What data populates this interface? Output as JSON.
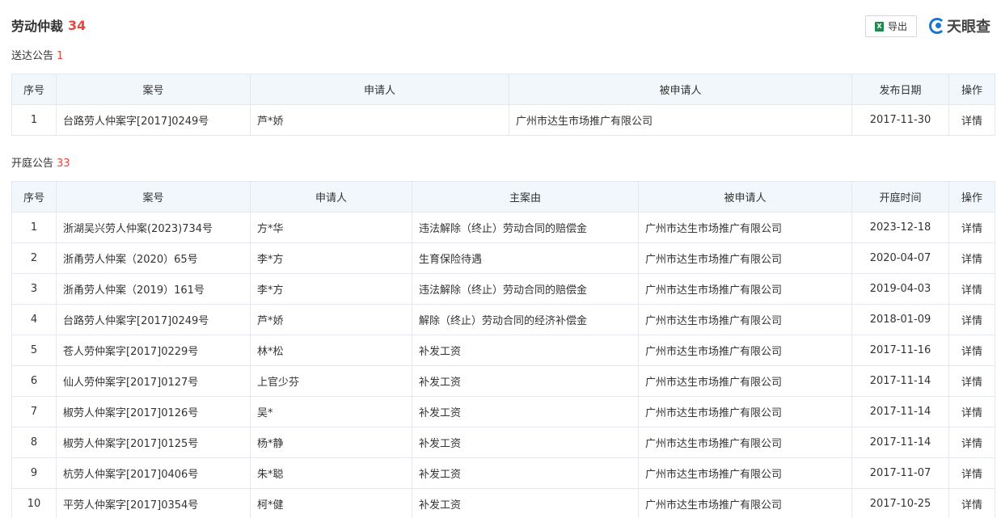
{
  "header": {
    "title": "劳动仲裁",
    "count": "34"
  },
  "toolbar": {
    "export_label": "导出",
    "excel_icon_text": "X"
  },
  "logo": {
    "text": "天眼查"
  },
  "service_notice": {
    "label": "送达公告",
    "count": "1",
    "columns": [
      "序号",
      "案号",
      "申请人",
      "被申请人",
      "发布日期",
      "操作"
    ],
    "rows": [
      {
        "no": "1",
        "case_no": "台路劳人仲案字[2017]0249号",
        "applicant": "芦*娇",
        "respondent": "广州市达生市场推广有限公司",
        "date": "2017-11-30",
        "action": "详情"
      }
    ]
  },
  "court_notice": {
    "label": "开庭公告",
    "count": "33",
    "columns": [
      "序号",
      "案号",
      "申请人",
      "主案由",
      "被申请人",
      "开庭时间",
      "操作"
    ],
    "rows": [
      {
        "no": "1",
        "case_no": "浙湖吴兴劳人仲案(2023)734号",
        "applicant": "方*华",
        "cause": "违法解除（终止）劳动合同的赔偿金",
        "respondent": "广州市达生市场推广有限公司",
        "date": "2023-12-18",
        "action": "详情"
      },
      {
        "no": "2",
        "case_no": "浙甬劳人仲案（2020）65号",
        "applicant": "李*方",
        "cause": "生育保险待遇",
        "respondent": "广州市达生市场推广有限公司",
        "date": "2020-04-07",
        "action": "详情"
      },
      {
        "no": "3",
        "case_no": "浙甬劳人仲案（2019）161号",
        "applicant": "李*方",
        "cause": "违法解除（终止）劳动合同的赔偿金",
        "respondent": "广州市达生市场推广有限公司",
        "date": "2019-04-03",
        "action": "详情"
      },
      {
        "no": "4",
        "case_no": "台路劳人仲案字[2017]0249号",
        "applicant": "芦*娇",
        "cause": "解除（终止）劳动合同的经济补偿金",
        "respondent": "广州市达生市场推广有限公司",
        "date": "2018-01-09",
        "action": "详情"
      },
      {
        "no": "5",
        "case_no": "苍人劳仲案字[2017]0229号",
        "applicant": "林*松",
        "cause": "补发工资",
        "respondent": "广州市达生市场推广有限公司",
        "date": "2017-11-16",
        "action": "详情"
      },
      {
        "no": "6",
        "case_no": "仙人劳仲案字[2017]0127号",
        "applicant": "上官少芬",
        "cause": "补发工资",
        "respondent": "广州市达生市场推广有限公司",
        "date": "2017-11-14",
        "action": "详情"
      },
      {
        "no": "7",
        "case_no": "椒劳人仲案字[2017]0126号",
        "applicant": "吴*",
        "cause": "补发工资",
        "respondent": "广州市达生市场推广有限公司",
        "date": "2017-11-14",
        "action": "详情"
      },
      {
        "no": "8",
        "case_no": "椒劳人仲案字[2017]0125号",
        "applicant": "杨*静",
        "cause": "补发工资",
        "respondent": "广州市达生市场推广有限公司",
        "date": "2017-11-14",
        "action": "详情"
      },
      {
        "no": "9",
        "case_no": "杭劳人仲案字[2017]0406号",
        "applicant": "朱*聪",
        "cause": "补发工资",
        "respondent": "广州市达生市场推广有限公司",
        "date": "2017-11-07",
        "action": "详情"
      },
      {
        "no": "10",
        "case_no": "平劳人仲案字[2017]0354号",
        "applicant": "柯*健",
        "cause": "补发工资",
        "respondent": "广州市达生市场推广有限公司",
        "date": "2017-10-25",
        "action": "详情"
      }
    ]
  }
}
